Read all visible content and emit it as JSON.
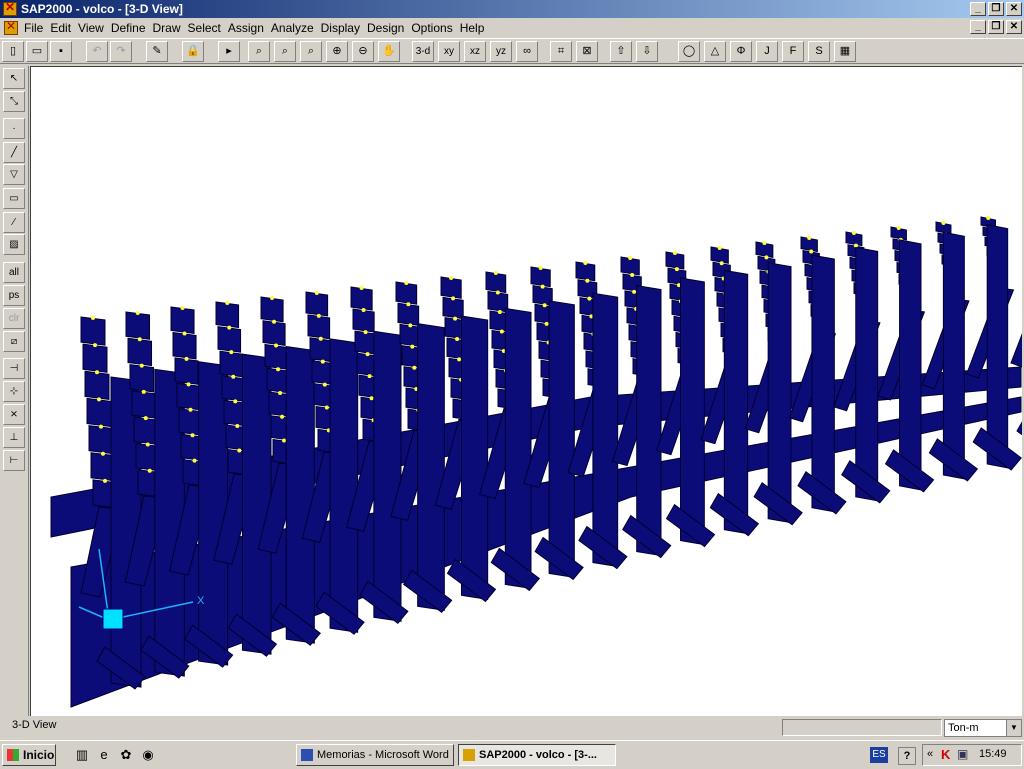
{
  "window": {
    "title": "SAP2000 - volco - [3-D View]"
  },
  "menu": [
    "File",
    "Edit",
    "View",
    "Define",
    "Draw",
    "Select",
    "Assign",
    "Analyze",
    "Display",
    "Design",
    "Options",
    "Help"
  ],
  "toolbar": {
    "view_3d": "3-d",
    "view_xy": "xy",
    "view_xz": "xz",
    "view_yz": "yz",
    "btn_J": "J",
    "btn_F": "F",
    "btn_S": "S"
  },
  "lefttoolbar": {
    "all": "all",
    "ps": "ps",
    "clr": "clr"
  },
  "canvas": {
    "axis_x": "X"
  },
  "status": {
    "text": "3-D View",
    "units": "Ton-m"
  },
  "taskbar": {
    "start": "Inicio",
    "tasks": [
      "Memorias - Microsoft Word",
      "SAP2000 - volco - [3-..."
    ],
    "lang": "ES",
    "help": "?",
    "time": "15:49"
  }
}
